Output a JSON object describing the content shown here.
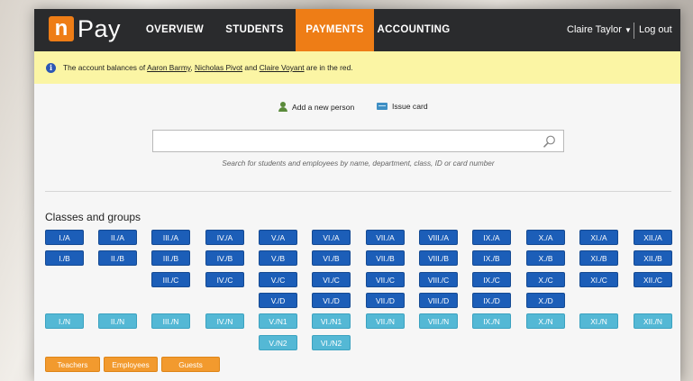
{
  "app": {
    "logo_letter": "n",
    "logo_text": "Pay"
  },
  "nav": {
    "items": [
      {
        "label": "OVERVIEW",
        "active": false
      },
      {
        "label": "STUDENTS",
        "active": false
      },
      {
        "label": "PAYMENTS",
        "active": true
      },
      {
        "label": "ACCOUNTING",
        "active": false
      }
    ]
  },
  "user": {
    "name": "Claire Taylor",
    "logout_label": "Log out"
  },
  "notice": {
    "prefix": "The account balances of ",
    "person1": "Aaron Barmy",
    "sep1": ", ",
    "person2": "Nicholas Pivot",
    "sep2": " and ",
    "person3": "Claire Voyant",
    "suffix": " are in the red."
  },
  "actions": {
    "add_person": "Add a new person",
    "issue_card": "Issue card"
  },
  "search": {
    "value": "",
    "hint": "Search for students and employees by name, department, class, ID or card number"
  },
  "classes": {
    "title": "Classes and groups",
    "rows": [
      [
        "I./A",
        "II./A",
        "III./A",
        "IV./A",
        "V./A",
        "VI./A",
        "VII./A",
        "VIII./A",
        "IX./A",
        "X./A",
        "XI./A",
        "XII./A"
      ],
      [
        "I./B",
        "II./B",
        "III./B",
        "IV./B",
        "V./B",
        "VI./B",
        "VII./B",
        "VIII./B",
        "IX./B",
        "X./B",
        "XI./B",
        "XII./B"
      ],
      [
        "",
        "",
        "III./C",
        "IV./C",
        "V./C",
        "VI./C",
        "VII./C",
        "VIII./C",
        "IX./C",
        "X./C",
        "XI./C",
        "XII./C"
      ],
      [
        "",
        "",
        "",
        "",
        "V./D",
        "VI./D",
        "VII./D",
        "VIII./D",
        "IX./D",
        "X./D",
        "",
        ""
      ],
      [
        "I./N",
        "II./N",
        "III./N",
        "IV./N",
        "V./N1",
        "VI./N1",
        "VII./N",
        "VIII./N",
        "IX./N",
        "X./N",
        "XI./N",
        "XII./N"
      ],
      [
        "",
        "",
        "",
        "",
        "V./N2",
        "VI./N2",
        "",
        "",
        "",
        "",
        "",
        ""
      ]
    ],
    "groups": [
      "Teachers",
      "Employees",
      "Guests"
    ]
  },
  "colors": {
    "accent": "#ee7d16",
    "header_bg": "#2a2b2d",
    "class_button": "#1c5eb8",
    "group_button": "#54b8d5",
    "staff_button": "#f29a2e",
    "notice_bg": "#fbf5a4"
  },
  "icons": {
    "info": "info-icon",
    "add_person": "person-add-icon",
    "issue_card": "card-icon",
    "search": "search-icon",
    "user_menu": "caret-down-icon"
  }
}
